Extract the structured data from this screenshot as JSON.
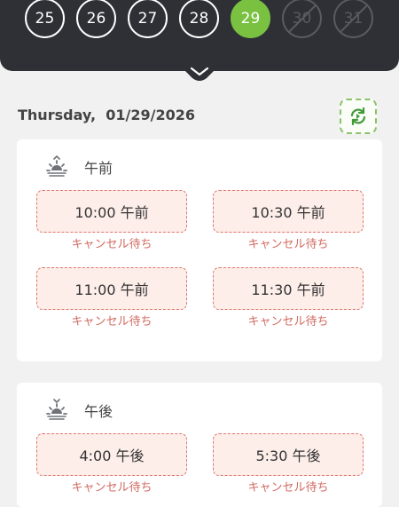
{
  "date_strip": {
    "days": [
      {
        "label": "25",
        "state": "normal"
      },
      {
        "label": "26",
        "state": "normal"
      },
      {
        "label": "27",
        "state": "normal"
      },
      {
        "label": "28",
        "state": "normal"
      },
      {
        "label": "29",
        "state": "selected"
      },
      {
        "label": "30",
        "state": "disabled"
      },
      {
        "label": "31",
        "state": "disabled"
      }
    ],
    "selected_color": "#7ac142",
    "background_color": "#2e3036"
  },
  "header": {
    "date_text": "Thursday,  01/29/2026",
    "refresh_icon": "refresh-icon"
  },
  "morning": {
    "title": "午前",
    "icon": "sunrise-icon",
    "slots": [
      {
        "time": "10:00 午前",
        "status": "キャンセル待ち"
      },
      {
        "time": "10:30 午前",
        "status": "キャンセル待ち"
      },
      {
        "time": "11:00 午前",
        "status": "キャンセル待ち"
      },
      {
        "time": "11:30 午前",
        "status": "キャンセル待ち"
      }
    ]
  },
  "afternoon": {
    "title": "午後",
    "icon": "sunset-icon",
    "slots": [
      {
        "time": "4:00 午後",
        "status": "キャンセル待ち"
      },
      {
        "time": "5:30 午後",
        "status": "キャンセル待ち"
      }
    ]
  },
  "colors": {
    "slot_border": "#e0756d",
    "slot_background": "#fdeee9",
    "status_text": "#d16a61",
    "refresh_border": "#8cc26a"
  }
}
